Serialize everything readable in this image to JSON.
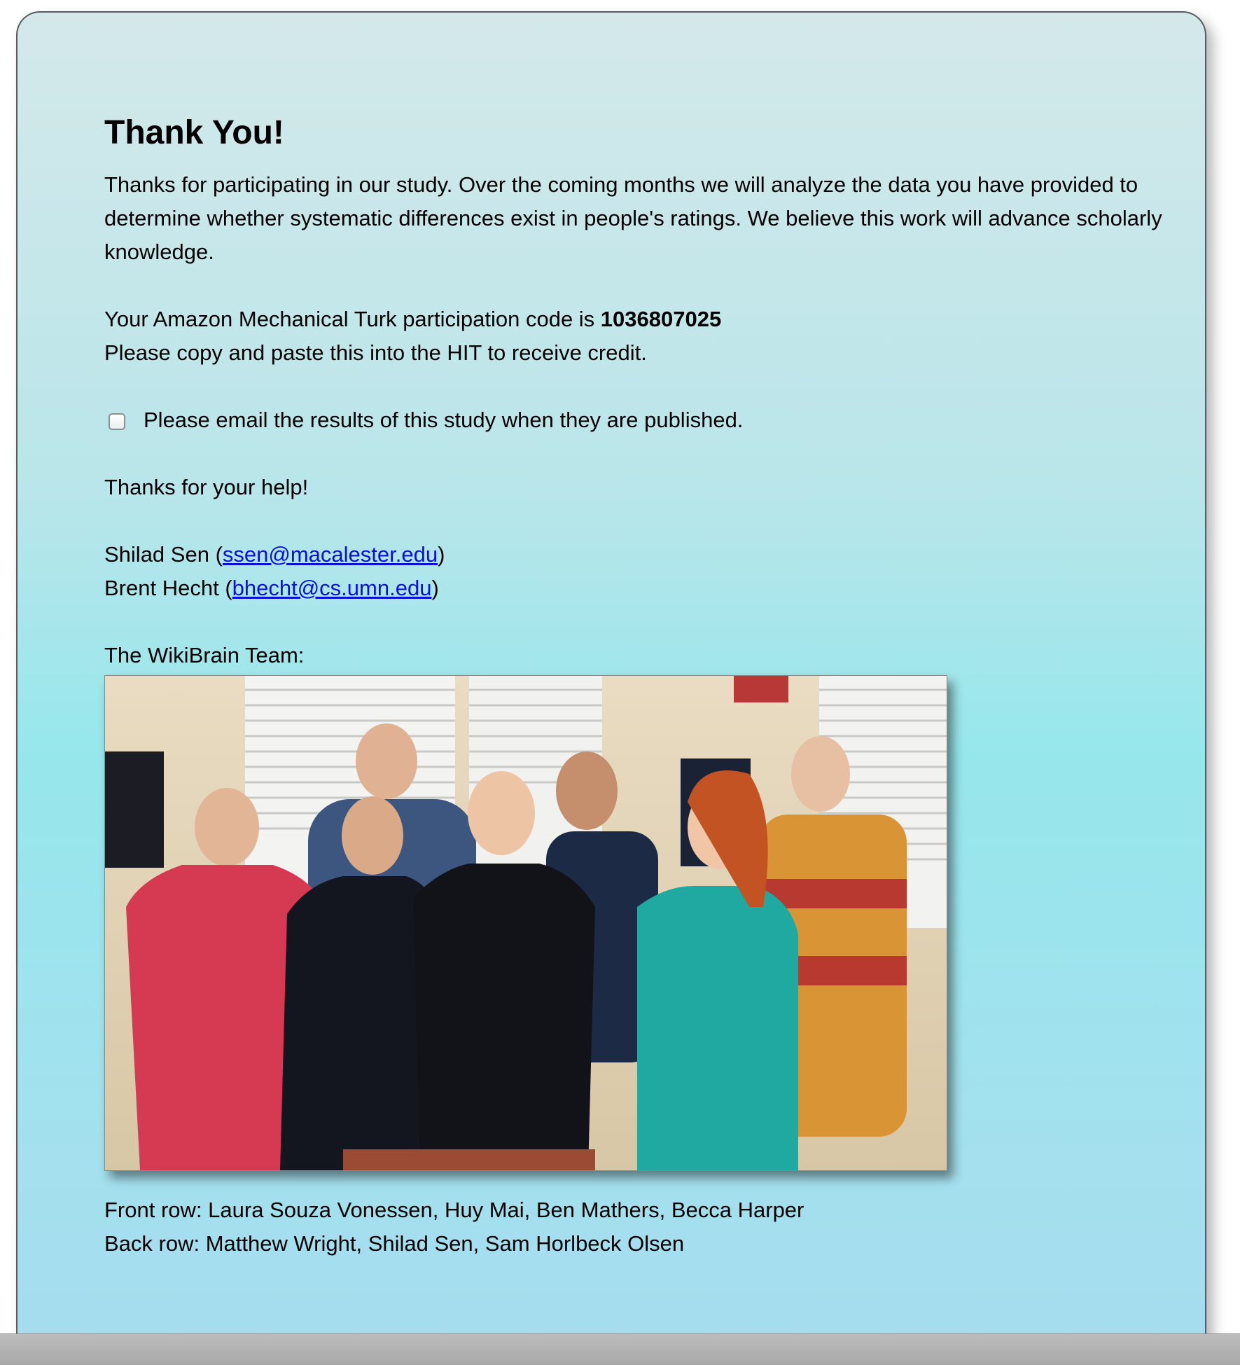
{
  "page": {
    "title": "Thank You!",
    "intro": "Thanks for participating in our study. Over the coming months we will analyze the data you have provided to determine whether systematic differences exist in people's ratings. We believe this work will advance scholarly knowledge.",
    "code_prefix": "Your Amazon Mechanical Turk participation code is ",
    "code_value": "1036807025",
    "code_instructions": "Please copy and paste this into the HIT to receive credit.",
    "optin_label": "Please email the results of this study when they are published.",
    "optin_checked": false,
    "thanks": "Thanks for your help!"
  },
  "contacts": [
    {
      "name": "Shilad Sen",
      "email": "ssen@macalester.edu"
    },
    {
      "name": "Brent Hecht",
      "email": "bhecht@cs.umn.edu"
    }
  ],
  "team": {
    "label": "The WikiBrain Team:",
    "caption_front": "Front row: Laura Souza Vonessen, Huy Mai, Ben Mathers, Becca Harper",
    "caption_back": "Back row: Matthew Wright, Shilad Sen, Sam Horlbeck Olsen"
  },
  "colors": {
    "link": "#0a10d8",
    "panel_top": "#d4e8ea",
    "panel_mid": "#96e7ec",
    "panel_bottom": "#a6dcee"
  }
}
